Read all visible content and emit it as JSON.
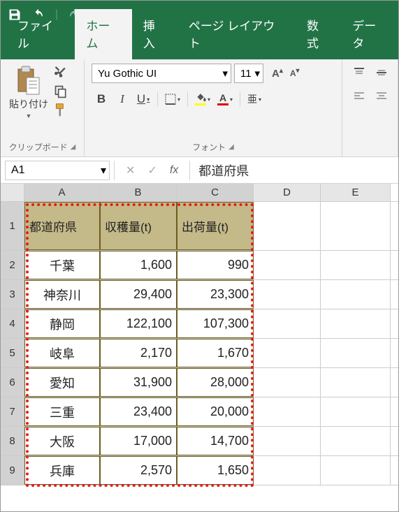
{
  "titlebar": {
    "save": "save",
    "undo": "undo",
    "redo": "redo"
  },
  "tabs": {
    "file": "ファイル",
    "home": "ホーム",
    "insert": "挿入",
    "pagelayout": "ページ レイアウト",
    "formulas": "数式",
    "data": "データ"
  },
  "ribbon": {
    "paste_label": "貼り付け",
    "clipboard_label": "クリップボード",
    "font_name": "Yu Gothic UI",
    "font_size": "11",
    "font_label": "フォント",
    "bold": "B",
    "italic": "I",
    "underline": "U",
    "inc": "A",
    "dec": "A",
    "ruby": "亜",
    "fontcolor_letter": "A"
  },
  "formula": {
    "cell_ref": "A1",
    "fx": "fx",
    "value": "都道府県",
    "cancel": "✕",
    "confirm": "✓"
  },
  "columns": [
    "A",
    "B",
    "C",
    "D",
    "E"
  ],
  "headers": {
    "col1": "都道府県",
    "col2": "収穫量(t)",
    "col3": "出荷量(t)"
  },
  "rows": [
    {
      "n": "1"
    },
    {
      "n": "2",
      "pref": "千葉",
      "harvest": "1,600",
      "ship": "990"
    },
    {
      "n": "3",
      "pref": "神奈川",
      "harvest": "29,400",
      "ship": "23,300"
    },
    {
      "n": "4",
      "pref": "静岡",
      "harvest": "122,100",
      "ship": "107,300"
    },
    {
      "n": "5",
      "pref": "岐阜",
      "harvest": "2,170",
      "ship": "1,670"
    },
    {
      "n": "6",
      "pref": "愛知",
      "harvest": "31,900",
      "ship": "28,000"
    },
    {
      "n": "7",
      "pref": "三重",
      "harvest": "23,400",
      "ship": "20,000"
    },
    {
      "n": "8",
      "pref": "大阪",
      "harvest": "17,000",
      "ship": "14,700"
    },
    {
      "n": "9",
      "pref": "兵庫",
      "harvest": "2,570",
      "ship": "1,650"
    }
  ],
  "chart_data": {
    "type": "table",
    "title": "",
    "columns": [
      "都道府県",
      "収穫量(t)",
      "出荷量(t)"
    ],
    "data": [
      [
        "千葉",
        1600,
        990
      ],
      [
        "神奈川",
        29400,
        23300
      ],
      [
        "静岡",
        122100,
        107300
      ],
      [
        "岐阜",
        2170,
        1670
      ],
      [
        "愛知",
        31900,
        28000
      ],
      [
        "三重",
        23400,
        20000
      ],
      [
        "大阪",
        17000,
        14700
      ],
      [
        "兵庫",
        2570,
        1650
      ]
    ]
  }
}
